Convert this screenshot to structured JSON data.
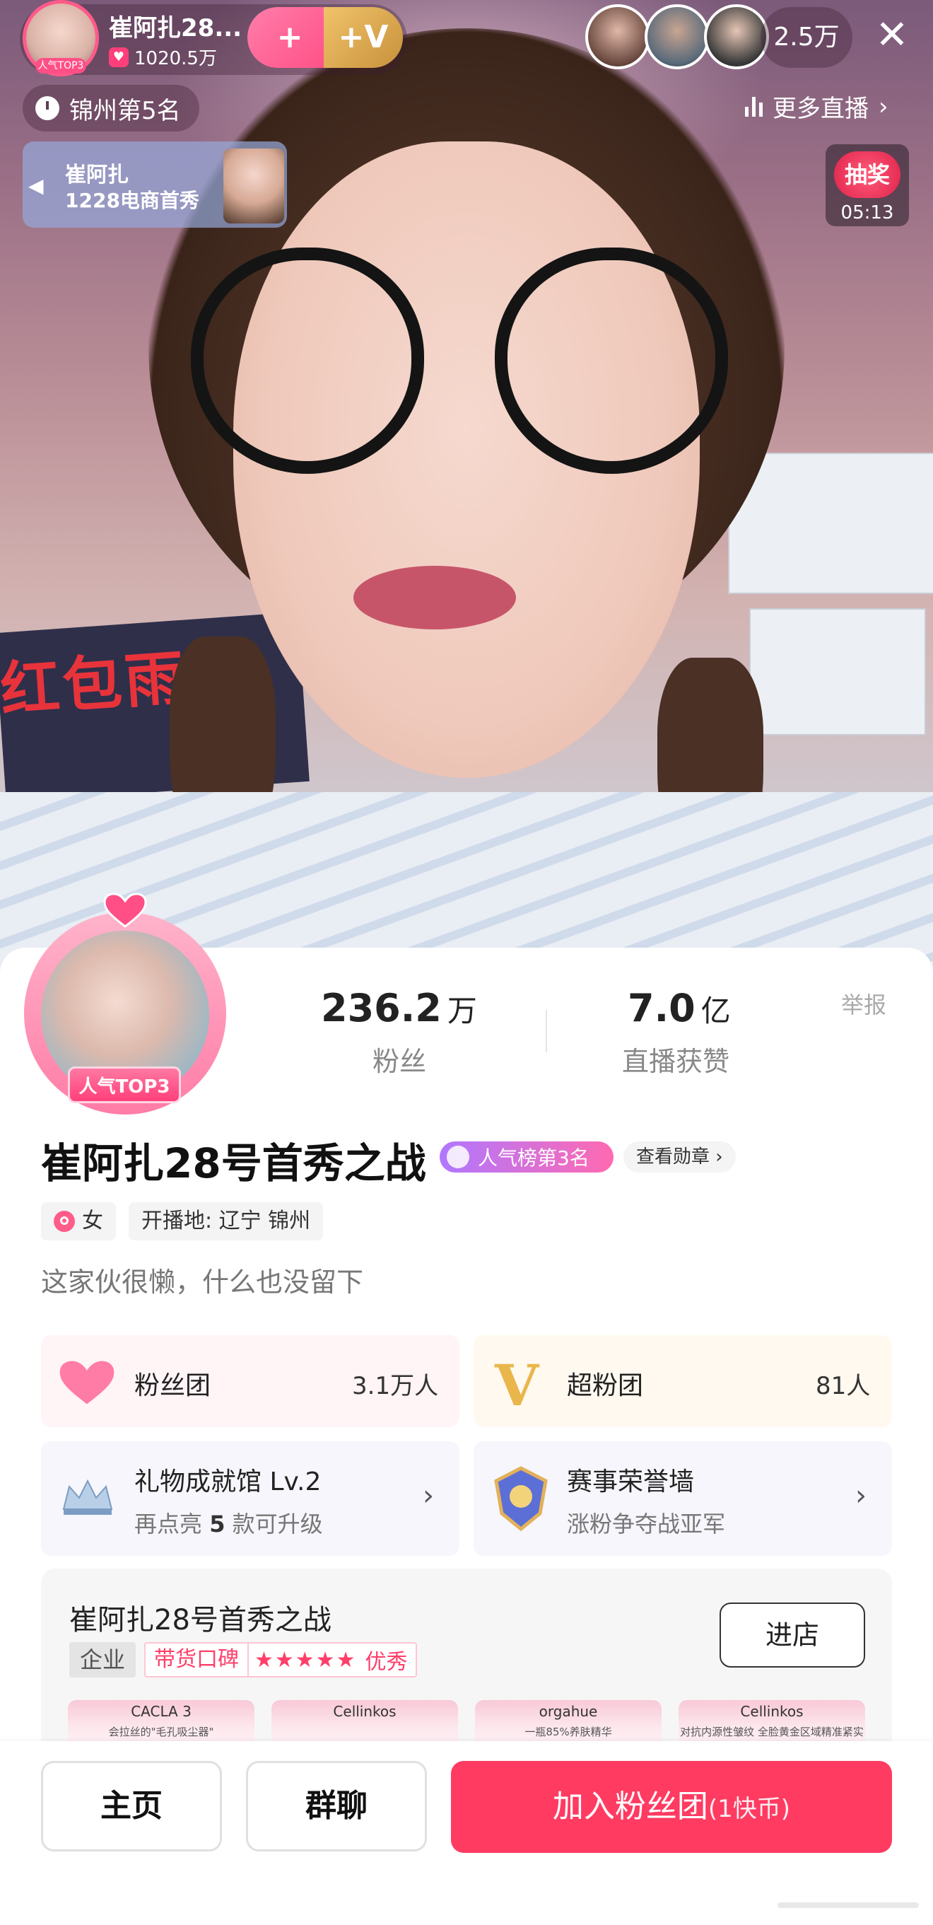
{
  "live": {
    "host_name": "崔阿扎28...",
    "host_likes": "1020.5万",
    "host_badge": "人气TOP3",
    "follow_label": "+",
    "super_label": "+V",
    "viewer_count": "2.5万",
    "rank_text": "锦州第5名",
    "more_live": "更多直播",
    "promo_line1": "崔阿扎",
    "promo_line2": "1228电商首秀",
    "lottery_label": "抽奖",
    "lottery_time": "05:13",
    "banner_text": "红包雨"
  },
  "profile": {
    "badge": "人气TOP3",
    "fans_value": "236.2",
    "fans_unit": "万",
    "fans_label": "粉丝",
    "likes_value": "7.0",
    "likes_unit": "亿",
    "likes_label": "直播获赞",
    "report": "举报",
    "nickname": "崔阿扎28号首秀之战",
    "rank_badge": "人气榜第3名",
    "medal_link": "查看勋章",
    "gender": "女",
    "location": "开播地: 辽宁 锦州",
    "bio": "这家伙很懒，什么也没留下"
  },
  "cards": {
    "fan_club": {
      "title": "粉丝团",
      "count": "3.1万人"
    },
    "super_club": {
      "title": "超粉团",
      "count": "81人"
    },
    "gift_hall": {
      "title": "礼物成就馆 Lv.2",
      "sub_prefix": "再点亮",
      "sub_num": "5",
      "sub_suffix": "款可升级"
    },
    "honor_wall": {
      "title": "赛事荣誉墙",
      "sub": "涨粉争夺战亚军"
    }
  },
  "shop": {
    "name": "崔阿扎28号首秀之战",
    "ent_tag": "企业",
    "rep_label": "带货口碑",
    "stars": "★★★★★",
    "rating": 4.5,
    "rep_level": "优秀",
    "visit_label": "进店",
    "thumbs": [
      {
        "brand": "CACLA 3",
        "text": "会拉丝的\"毛孔吸尘器\""
      },
      {
        "brand": "Cellinkos",
        "text": ""
      },
      {
        "brand": "orgahue",
        "text": "一瓶85%养肤精华"
      },
      {
        "brand": "Cellinkos",
        "text": "对抗内源性皱纹 全脸黄金区域精准紧实"
      }
    ]
  },
  "bottom": {
    "home": "主页",
    "group_chat": "群聊",
    "join": "加入粉丝团",
    "join_price": "(1快币)"
  },
  "colors": {
    "accent": "#ff3b62",
    "pink": "#ff4f86",
    "gold": "#c8913c"
  },
  "icons": [
    "heart-icon",
    "v-icon",
    "close-icon",
    "clock-icon",
    "bars-icon",
    "chevron-right-icon",
    "female-icon",
    "crown-icon",
    "trophy-icon",
    "star-icon"
  ]
}
